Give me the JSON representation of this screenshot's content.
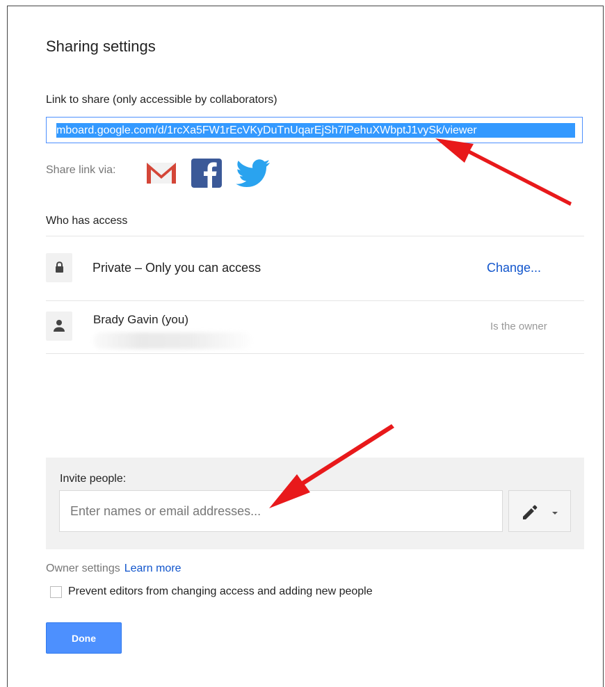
{
  "dialog": {
    "title": "Sharing settings",
    "link_label": "Link to share (only accessible by collaborators)",
    "link_url": "mboard.google.com/d/1rcXa5FW1rEcVKyDuTnUqarEjSh7lPehuXWbptJ1vySk/viewer",
    "share_via_label": "Share link via:",
    "share_icons": [
      "gmail-icon",
      "facebook-icon",
      "twitter-icon"
    ],
    "who_has_access_label": "Who has access",
    "access_rows": [
      {
        "icon": "lock-icon",
        "text": "Private – Only you can access",
        "action": "Change..."
      },
      {
        "icon": "person-icon",
        "text": "Brady Gavin (you)",
        "role": "Is the owner"
      }
    ],
    "invite": {
      "label": "Invite people:",
      "placeholder": "Enter names or email addresses...",
      "permission_icon": "pencil-icon"
    },
    "owner_settings_label": "Owner settings",
    "learn_more_label": "Learn more",
    "prevent_label": "Prevent editors from changing access and adding new people",
    "prevent_checked": false,
    "done_label": "Done"
  },
  "colors": {
    "link": "#1155cc",
    "primary_button": "#4d90fe",
    "annotation_arrow": "#e8191b"
  }
}
